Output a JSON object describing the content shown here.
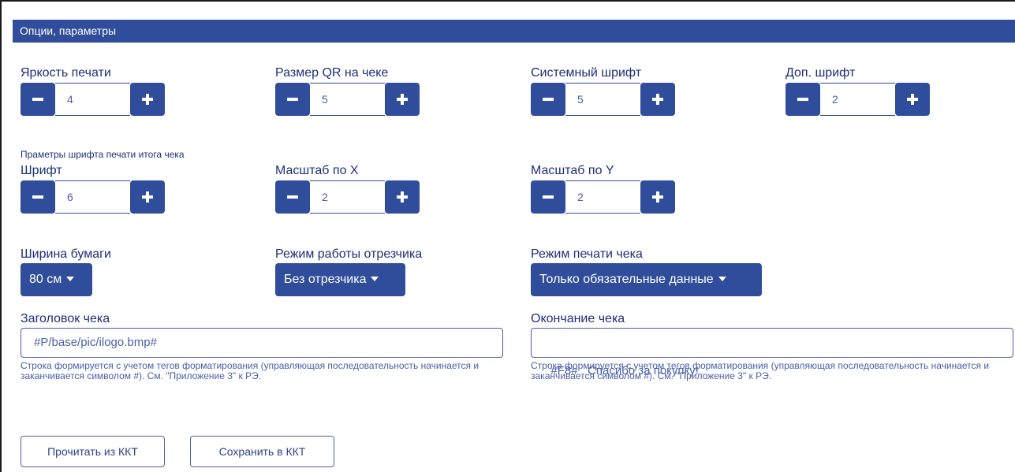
{
  "header": {
    "title": "Опции, параметры"
  },
  "row1": [
    {
      "label": "Яркость печати",
      "value": "4"
    },
    {
      "label": "Размер QR на чеке",
      "value": "5"
    },
    {
      "label": "Системный шрифт",
      "value": "5"
    },
    {
      "label": "Доп. шрифт",
      "value": "2"
    }
  ],
  "total_font_note": "Праметры шрифта печати итога чека",
  "row2": [
    {
      "label": "Шрифт",
      "value": "6"
    },
    {
      "label": "Масштаб по X",
      "value": "2"
    },
    {
      "label": "Масштаб по Y",
      "value": "2"
    }
  ],
  "paper_width": {
    "label": "Ширина бумаги",
    "value": "80 см"
  },
  "cutter_mode": {
    "label": "Режим работы отрезчика",
    "value": "Без отрезчика"
  },
  "print_mode": {
    "label": "Режим печати чека",
    "value": "Только обязательные данные"
  },
  "receipt_header": {
    "label": "Заголовок чека",
    "value": "#P/base/pic/ilogo.bmp#",
    "help": "Строка формируется с учетом тегов форматирования (управляющая последовательность начинается и заканчивается символом #). См. \"Приложение 3\" к РЭ."
  },
  "receipt_footer": {
    "label": "Окончание чека",
    "value": "#F8#   Спасибо за покупку!",
    "help": "Строка формируется с учетом тегов форматирования (управляющая последовательность начинается и заканчивается символом #). См. \"Приложение 3\" к РЭ."
  },
  "actions": {
    "read": "Прочитать из ККТ",
    "save": "Сохранить в ККТ"
  },
  "colors": {
    "accent": "#2f4d9a",
    "text": "#1f2f7a"
  }
}
